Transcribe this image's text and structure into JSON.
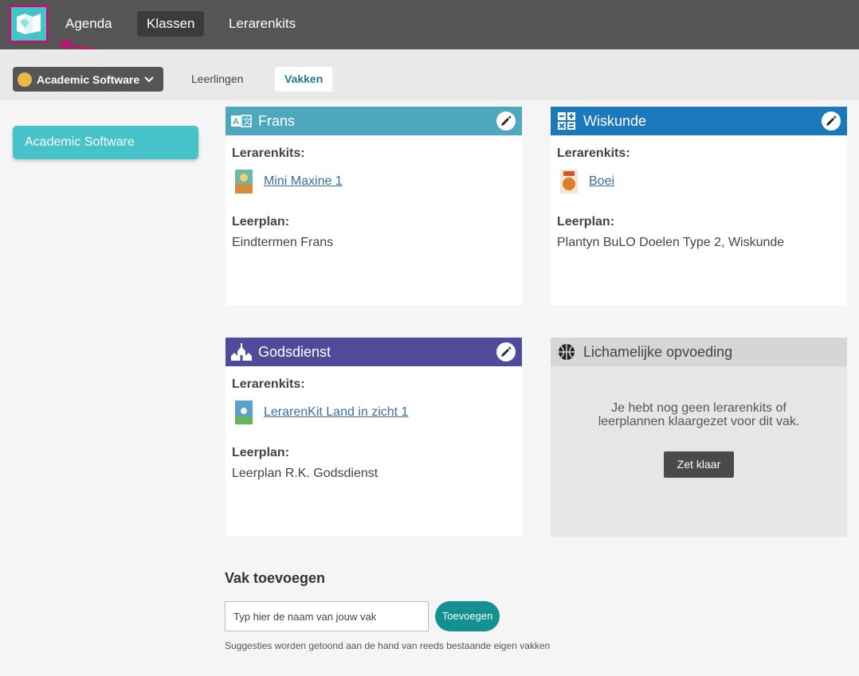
{
  "nav": {
    "logo": "app-logo",
    "items": [
      {
        "label": "Agenda"
      },
      {
        "label": "Klassen",
        "active": true
      },
      {
        "label": "Lerarenkits"
      }
    ]
  },
  "subbar": {
    "class_select": "Academic Software",
    "tabs": [
      {
        "label": "Leerlingen"
      },
      {
        "label": "Vakken",
        "active": true
      }
    ]
  },
  "sidebar": {
    "class_label": "Academic Software"
  },
  "subjects": [
    {
      "name": "Frans",
      "color": "#4ea8bd",
      "kits_label": "Lerarenkits:",
      "kit": "Mini Maxine 1",
      "plan_label": "Leerplan:",
      "plan": "Eindtermen Frans"
    },
    {
      "name": "Wiskunde",
      "color": "#1a78bb",
      "kits_label": "Lerarenkits:",
      "kit": "Boei",
      "plan_label": "Leerplan:",
      "plan": "Plantyn BuLO Doelen Type 2, Wiskunde"
    },
    {
      "name": "Godsdienst",
      "color": "#4f4b9a",
      "kits_label": "Lerarenkits:",
      "kit": "LerarenKit Land in zicht 1",
      "plan_label": "Leerplan:",
      "plan": "Leerplan R.K. Godsdienst"
    },
    {
      "name": "Lichamelijke opvoeding",
      "color": "#d6d6d6",
      "empty_line1": "Je hebt nog geen lerarenkits of",
      "empty_line2": "leerplannen klaargezet voor dit vak.",
      "button": "Zet klaar"
    }
  ],
  "add_subject": {
    "title": "Vak toevoegen",
    "placeholder": "Typ hier de naam van jouw vak",
    "button": "Toevoegen",
    "hint": "Suggesties worden getoond aan de hand van reeds bestaande eigen vakken"
  }
}
